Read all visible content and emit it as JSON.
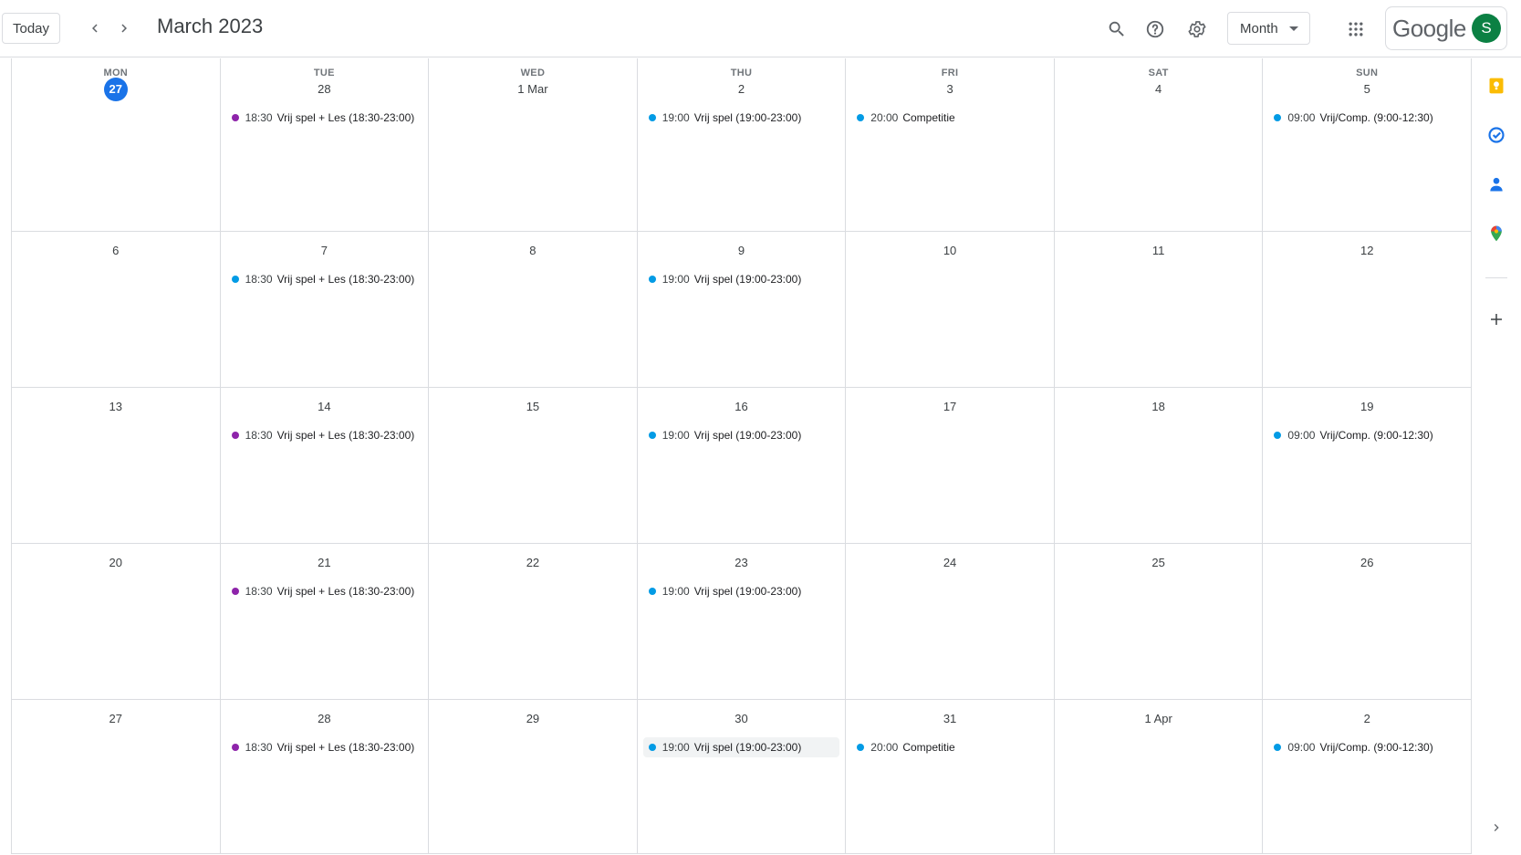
{
  "header": {
    "today_label": "Today",
    "title": "March 2023",
    "view_label": "Month",
    "logo_text": "Google",
    "avatar_letter": "S"
  },
  "colors": {
    "purple_event": "#8e24aa",
    "blue_event": "#039be5",
    "today_badge": "#1a73e8",
    "avatar_bg": "#0b8043"
  },
  "weekdays": [
    "MON",
    "TUE",
    "WED",
    "THU",
    "FRI",
    "SAT",
    "SUN"
  ],
  "weeks": [
    {
      "days": [
        {
          "label": "27",
          "today": true,
          "events": []
        },
        {
          "label": "28",
          "events": [
            {
              "time": "18:30",
              "title": "Vrij spel + Les (18:30-23:00)",
              "color": "#8e24aa"
            }
          ]
        },
        {
          "label": "1 Mar",
          "events": []
        },
        {
          "label": "2",
          "events": [
            {
              "time": "19:00",
              "title": "Vrij spel (19:00-23:00)",
              "color": "#039be5"
            }
          ]
        },
        {
          "label": "3",
          "events": [
            {
              "time": "20:00",
              "title": "Competitie",
              "color": "#039be5"
            }
          ]
        },
        {
          "label": "4",
          "events": []
        },
        {
          "label": "5",
          "events": [
            {
              "time": "09:00",
              "title": "Vrij/Comp. (9:00-12:30)",
              "color": "#039be5"
            }
          ]
        }
      ]
    },
    {
      "days": [
        {
          "label": "6",
          "events": []
        },
        {
          "label": "7",
          "events": [
            {
              "time": "18:30",
              "title": "Vrij spel + Les (18:30-23:00)",
              "color": "#039be5"
            }
          ]
        },
        {
          "label": "8",
          "events": []
        },
        {
          "label": "9",
          "events": [
            {
              "time": "19:00",
              "title": "Vrij spel (19:00-23:00)",
              "color": "#039be5"
            }
          ]
        },
        {
          "label": "10",
          "events": []
        },
        {
          "label": "11",
          "events": []
        },
        {
          "label": "12",
          "events": []
        }
      ]
    },
    {
      "days": [
        {
          "label": "13",
          "events": []
        },
        {
          "label": "14",
          "events": [
            {
              "time": "18:30",
              "title": "Vrij spel + Les (18:30-23:00)",
              "color": "#8e24aa"
            }
          ]
        },
        {
          "label": "15",
          "events": []
        },
        {
          "label": "16",
          "events": [
            {
              "time": "19:00",
              "title": "Vrij spel (19:00-23:00)",
              "color": "#039be5"
            }
          ]
        },
        {
          "label": "17",
          "events": []
        },
        {
          "label": "18",
          "events": []
        },
        {
          "label": "19",
          "events": [
            {
              "time": "09:00",
              "title": "Vrij/Comp. (9:00-12:30)",
              "color": "#039be5"
            }
          ]
        }
      ]
    },
    {
      "days": [
        {
          "label": "20",
          "events": []
        },
        {
          "label": "21",
          "events": [
            {
              "time": "18:30",
              "title": "Vrij spel + Les (18:30-23:00)",
              "color": "#8e24aa"
            }
          ]
        },
        {
          "label": "22",
          "events": []
        },
        {
          "label": "23",
          "events": [
            {
              "time": "19:00",
              "title": "Vrij spel (19:00-23:00)",
              "color": "#039be5"
            }
          ]
        },
        {
          "label": "24",
          "events": []
        },
        {
          "label": "25",
          "events": []
        },
        {
          "label": "26",
          "events": []
        }
      ]
    },
    {
      "days": [
        {
          "label": "27",
          "events": []
        },
        {
          "label": "28",
          "events": [
            {
              "time": "18:30",
              "title": "Vrij spel + Les (18:30-23:00)",
              "color": "#8e24aa"
            }
          ]
        },
        {
          "label": "29",
          "events": []
        },
        {
          "label": "30",
          "events": [
            {
              "time": "19:00",
              "title": "Vrij spel (19:00-23:00)",
              "color": "#039be5",
              "highlighted": true
            }
          ]
        },
        {
          "label": "31",
          "events": [
            {
              "time": "20:00",
              "title": "Competitie",
              "color": "#039be5"
            }
          ]
        },
        {
          "label": "1 Apr",
          "events": []
        },
        {
          "label": "2",
          "events": [
            {
              "time": "09:00",
              "title": "Vrij/Comp. (9:00-12:30)",
              "color": "#039be5"
            }
          ]
        }
      ]
    }
  ],
  "side_panel": {
    "items": [
      "keep-icon",
      "tasks-icon",
      "contacts-icon",
      "maps-icon",
      "add-icon",
      "expand-icon"
    ]
  }
}
